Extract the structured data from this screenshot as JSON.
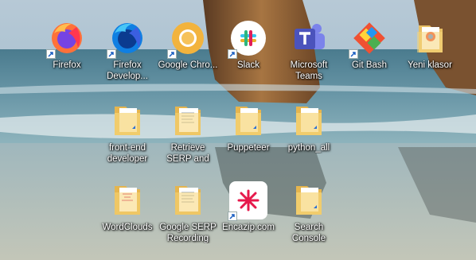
{
  "desktop": {
    "icons": [
      {
        "label": "Firefox",
        "icon": "firefox-icon"
      },
      {
        "label": "Firefox Develop...",
        "icon": "firefox-developer-icon"
      },
      {
        "label": "Google Chro...",
        "icon": "google-chrome-canary-icon"
      },
      {
        "label": "Slack",
        "icon": "slack-icon"
      },
      {
        "label": "Microsoft Teams",
        "icon": "microsoft-teams-icon"
      },
      {
        "label": "Git Bash",
        "icon": "git-bash-icon"
      },
      {
        "label": "Yeni klasor",
        "icon": "folder-icon"
      },
      {
        "label": "front-end developer",
        "icon": "folder-icon"
      },
      {
        "label": "Retrieve SERP and Analys...",
        "icon": "folder-icon"
      },
      {
        "label": "Puppeteer",
        "icon": "folder-icon"
      },
      {
        "label": "python_all",
        "icon": "folder-icon"
      },
      {
        "label": "WordClouds",
        "icon": "folder-icon"
      },
      {
        "label": "Google SERP Recording",
        "icon": "folder-icon"
      },
      {
        "label": "Encazip.com",
        "icon": "encazip-icon"
      },
      {
        "label": "Search Console",
        "icon": "folder-icon"
      }
    ]
  }
}
